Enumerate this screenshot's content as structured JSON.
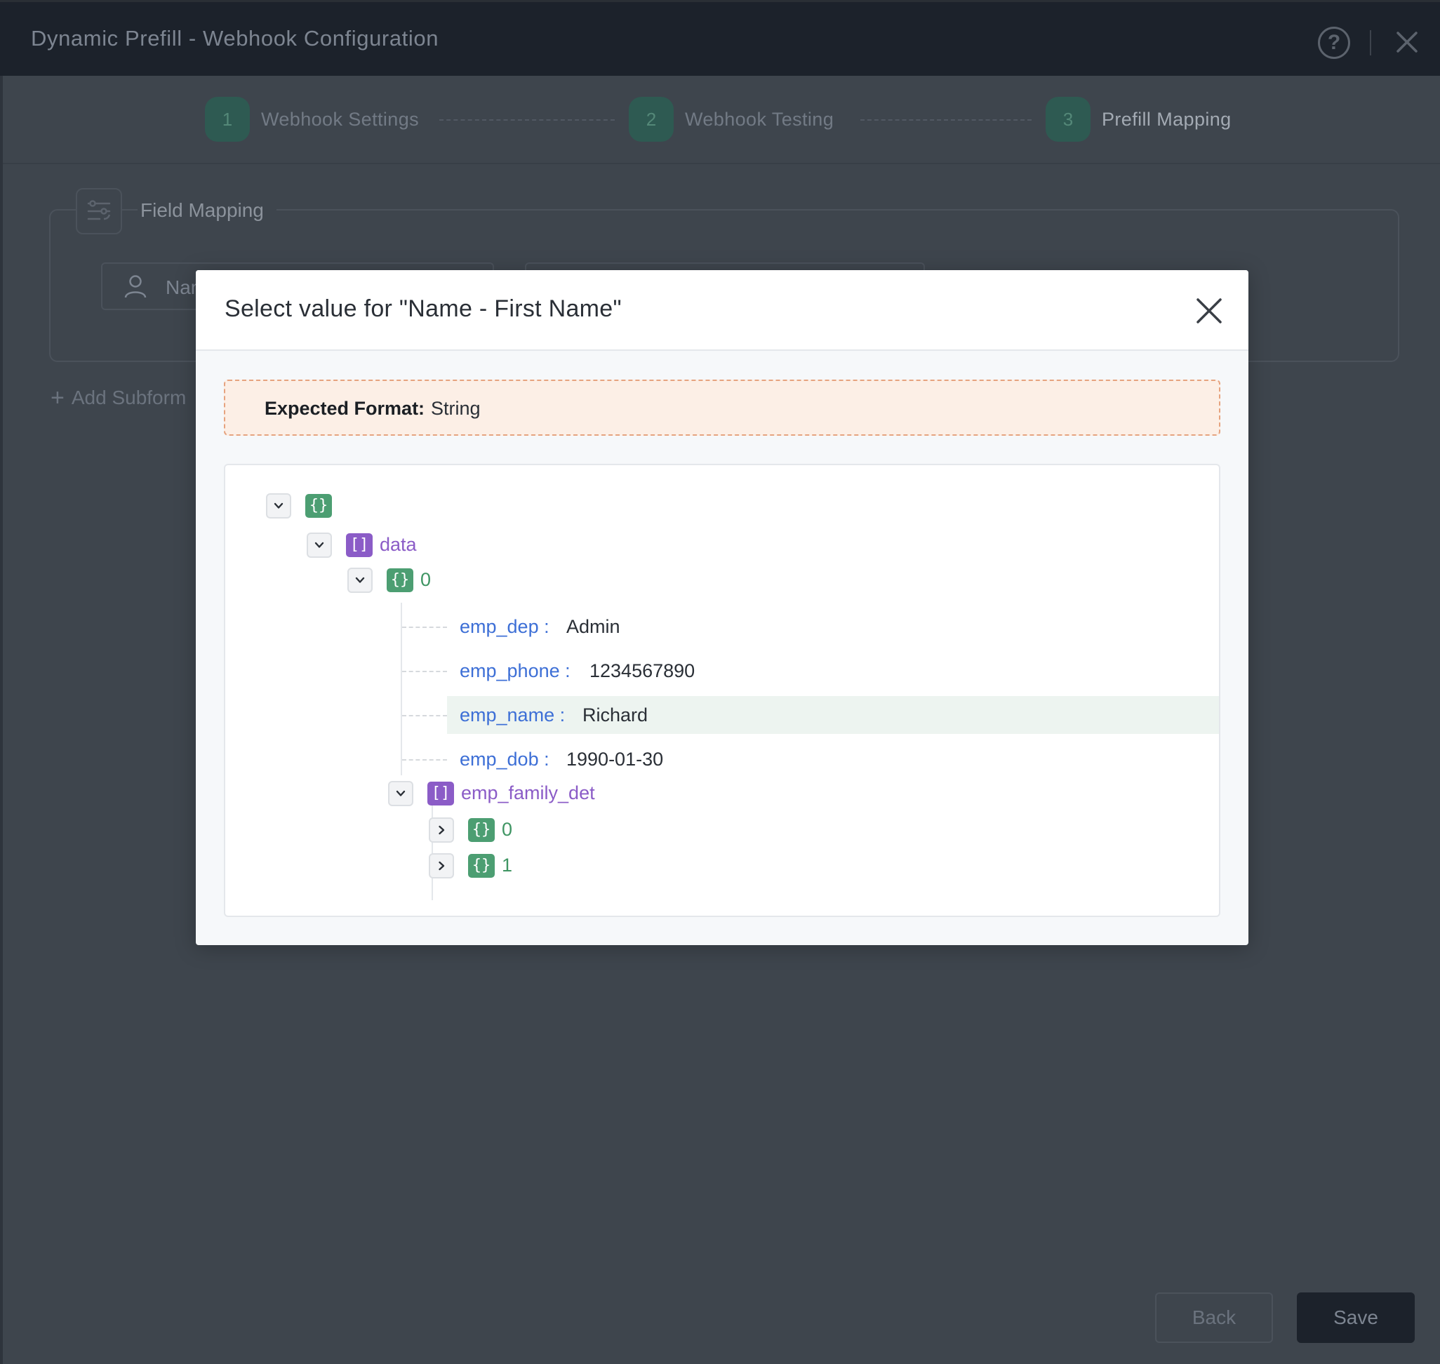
{
  "window": {
    "title": "Dynamic Prefill - Webhook Configuration"
  },
  "steps": [
    {
      "number": "1",
      "label": "Webhook Settings"
    },
    {
      "number": "2",
      "label": "Webhook Testing"
    },
    {
      "number": "3",
      "label": "Prefill Mapping"
    }
  ],
  "field_mapping": {
    "label": "Field Mapping",
    "field_text": "Nam",
    "add_subform_label": "Add Subform"
  },
  "footer": {
    "back_label": "Back",
    "save_label": "Save"
  },
  "modal": {
    "title": "Select value for \"Name - First Name\"",
    "expected_format_label": "Expected Format:",
    "expected_format_value": "String",
    "tree": {
      "root_badge": "{}",
      "data_badge": "[]",
      "data_key": "data",
      "item0_badge": "{}",
      "item0_key": "0",
      "fields": [
        {
          "key": "emp_dep",
          "value": "Admin"
        },
        {
          "key": "emp_phone",
          "value": "1234567890"
        },
        {
          "key": "emp_name",
          "value": "Richard"
        },
        {
          "key": "emp_dob",
          "value": "1990-01-30"
        }
      ],
      "family_badge": "[]",
      "family_key": "emp_family_det",
      "family_items": [
        {
          "badge": "{}",
          "key": "0"
        },
        {
          "badge": "{}",
          "key": "1"
        }
      ],
      "colon": ":"
    }
  }
}
